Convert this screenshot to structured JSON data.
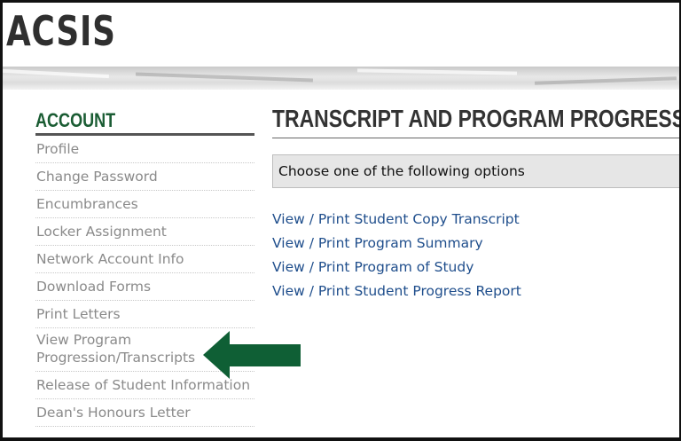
{
  "header": {
    "brand": "ACSIS"
  },
  "sidebar": {
    "title": "ACCOUNT",
    "items": [
      {
        "label": "Profile"
      },
      {
        "label": "Change Password"
      },
      {
        "label": "Encumbrances"
      },
      {
        "label": "Locker Assignment"
      },
      {
        "label": "Network Account Info"
      },
      {
        "label": "Download Forms"
      },
      {
        "label": "Print Letters"
      },
      {
        "label_line1": "View Program",
        "label_line2": "Progression/Transcripts"
      },
      {
        "label": "Release of Student Information"
      },
      {
        "label": "Dean's Honours Letter"
      }
    ]
  },
  "main": {
    "title": "TRANSCRIPT AND PROGRAM PROGRESSION",
    "options_text": "Choose one of the following options",
    "links": [
      {
        "label": "View / Print Student Copy Transcript"
      },
      {
        "label": "View / Print Program Summary"
      },
      {
        "label": "View / Print Program of Study"
      },
      {
        "label": "View / Print Student Progress Report"
      }
    ]
  },
  "colors": {
    "brand_green": "#1a5c33",
    "arrow_green": "#0f5f35",
    "link_blue": "#1f4e8c",
    "nav_gray": "#8a8a8a"
  },
  "icons": {
    "pointer": "left-arrow-icon"
  }
}
